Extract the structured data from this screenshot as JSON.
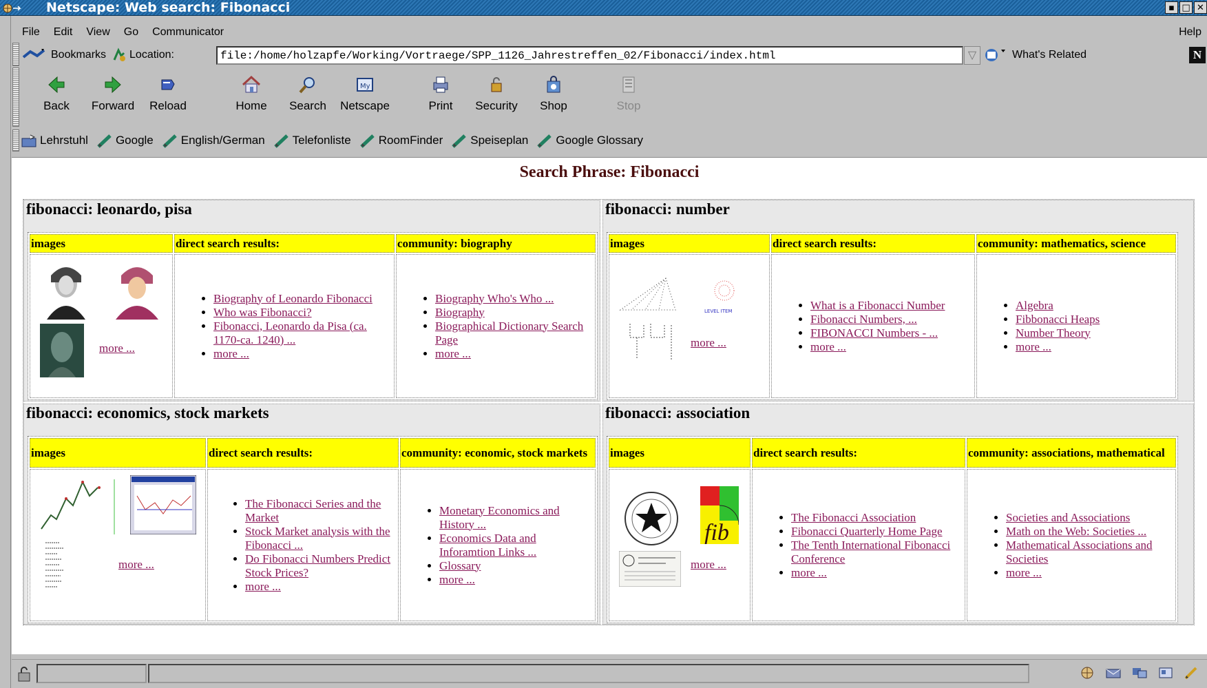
{
  "window": {
    "title": "Netscape: Web search: Fibonacci",
    "buttons": [
      "▪",
      "□",
      "✕"
    ]
  },
  "menu": {
    "items": [
      "File",
      "Edit",
      "View",
      "Go",
      "Communicator"
    ],
    "help": "Help"
  },
  "location_bar": {
    "bookmarks_label": "Bookmarks",
    "location_label": "Location:",
    "url": "file:/home/holzapfe/Working/Vortraege/SPP_1126_Jahrestreffen_02/Fibonacci/index.html",
    "whats_related": "What's Related",
    "logo": "N"
  },
  "nav_toolbar": {
    "back": "Back",
    "forward": "Forward",
    "reload": "Reload",
    "home": "Home",
    "search": "Search",
    "netscape": "Netscape",
    "print": "Print",
    "security": "Security",
    "shop": "Shop",
    "stop": "Stop"
  },
  "personal_toolbar": [
    "Lehrstuhl",
    "Google",
    "English/German",
    "Telefonliste",
    "RoomFinder",
    "Speiseplan",
    "Google Glossary"
  ],
  "page": {
    "heading": "Search Phrase: Fibonacci",
    "clusters": [
      {
        "title": "fibonacci: leonardo, pisa",
        "images_header": "images",
        "direct_header": "direct search results:",
        "community_header": "community: biography",
        "images_more": "more ...",
        "direct": [
          "Biography of Leonardo Fibonacci",
          "Who was Fibonacci?",
          "Fibonacci, Leonardo da Pisa (ca. 1170-ca. 1240) ...",
          "more ..."
        ],
        "community": [
          "Biography Who's Who ...",
          "Biography",
          "Biographical Dictionary Search Page",
          "more ..."
        ]
      },
      {
        "title": "fibonacci: number",
        "images_header": "images",
        "direct_header": "direct search results:",
        "community_header": "community: mathematics, science",
        "images_more": "more ...",
        "direct": [
          "What is a Fibonacci Number",
          "Fibonacci Numbers, ...",
          "FIBONACCI Numbers - ...",
          "more ..."
        ],
        "community": [
          "Algebra",
          "Fibbonacci Heaps",
          "Number Theory",
          "more ..."
        ]
      },
      {
        "title": "fibonacci: economics, stock markets",
        "images_header": "images",
        "direct_header": "direct search results:",
        "community_header": "community: economic, stock markets",
        "images_more": "more ...",
        "direct": [
          "The Fibonacci Series and the Market",
          "Stock Market analysis with the Fibonacci ...",
          "Do Fibonacci Numbers Predict Stock Prices?",
          "more ..."
        ],
        "community": [
          "Monetary Economics and History ...",
          "Economics Data and Inforamtion Links ...",
          "Glossary",
          "more ..."
        ]
      },
      {
        "title": "fibonacci: association",
        "images_header": "images",
        "direct_header": "direct search results:",
        "community_header": "community: associations, mathematical",
        "images_more": "more ...",
        "direct": [
          "The Fibonacci Association",
          "Fibonacci Quarterly Home Page",
          "The Tenth International Fibonacci Conference",
          "more ..."
        ],
        "community": [
          "Societies and Associations",
          "Math on the Web: Societies ...",
          "Mathematical Associations and Societies",
          "more ..."
        ]
      }
    ]
  }
}
